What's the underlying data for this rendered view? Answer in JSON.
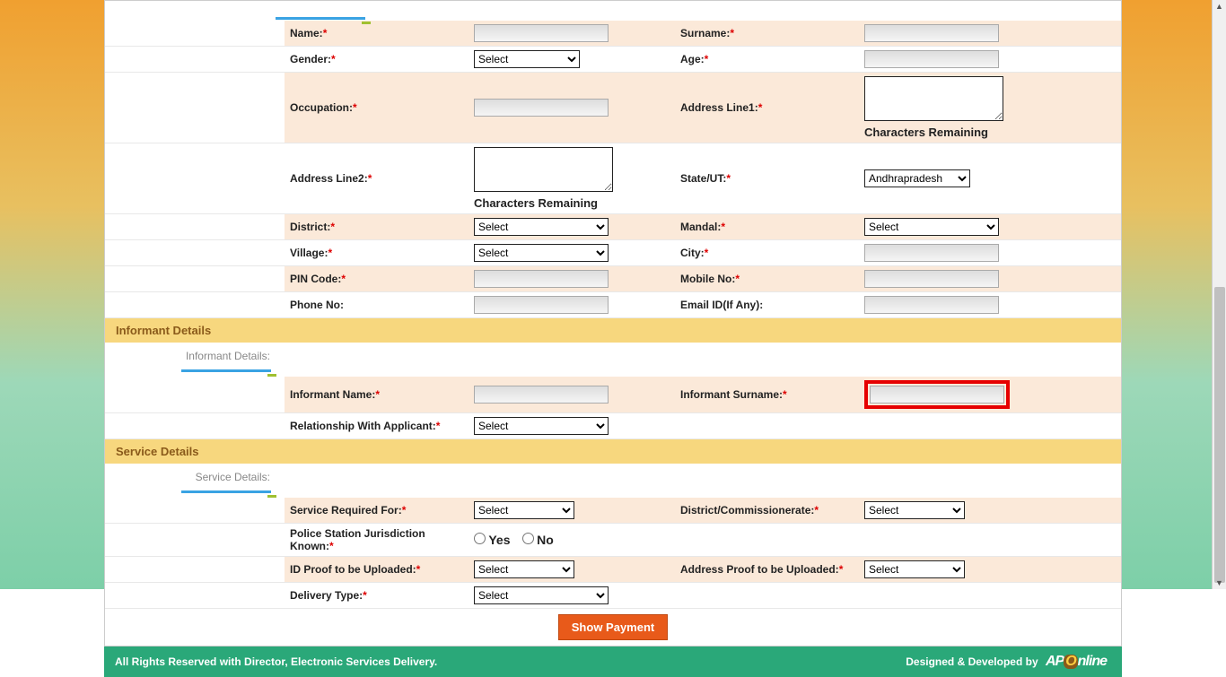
{
  "applicant": {
    "name_label": "Name:",
    "surname_label": "Surname:",
    "gender_label": "Gender:",
    "age_label": "Age:",
    "occupation_label": "Occupation:",
    "addr1_label": "Address Line1:",
    "addr2_label": "Address Line2:",
    "state_label": "State/UT:",
    "district_label": "District:",
    "mandal_label": "Mandal:",
    "village_label": "Village:",
    "city_label": "City:",
    "pin_label": "PIN Code:",
    "mobile_label": "Mobile No:",
    "phone_label": "Phone No:",
    "email_label": "Email ID(If Any):",
    "chars_remaining": "Characters Remaining",
    "gender_select": "Select",
    "state_selected": "Andhrapradesh",
    "district_select": "Select",
    "mandal_select": "Select",
    "village_select": "Select"
  },
  "informant": {
    "section_title": "Informant Details",
    "subtitle": "Informant Details:",
    "name_label": "Informant Name:",
    "surname_label": "Informant Surname:",
    "relationship_label": "Relationship With Applicant:",
    "relationship_select": "Select"
  },
  "service": {
    "section_title": "Service Details",
    "subtitle": "Service Details:",
    "required_for_label": "Service Required For:",
    "required_for_select": "Select",
    "district_comm_label": "District/Commissionerate:",
    "district_comm_select": "Select",
    "ps_known_label": "Police Station Jurisdiction Known:",
    "yes": "Yes",
    "no": "No",
    "id_proof_label": "ID Proof to be Uploaded:",
    "id_proof_select": "Select",
    "addr_proof_label": "Address Proof to be Uploaded:",
    "addr_proof_select": "Select",
    "delivery_label": "Delivery Type:",
    "delivery_select": "Select"
  },
  "buttons": {
    "show_payment": "Show Payment"
  },
  "footer": {
    "left": "All Rights Reserved with Director, Electronic Services Delivery.",
    "right": "Designed & Developed by"
  }
}
